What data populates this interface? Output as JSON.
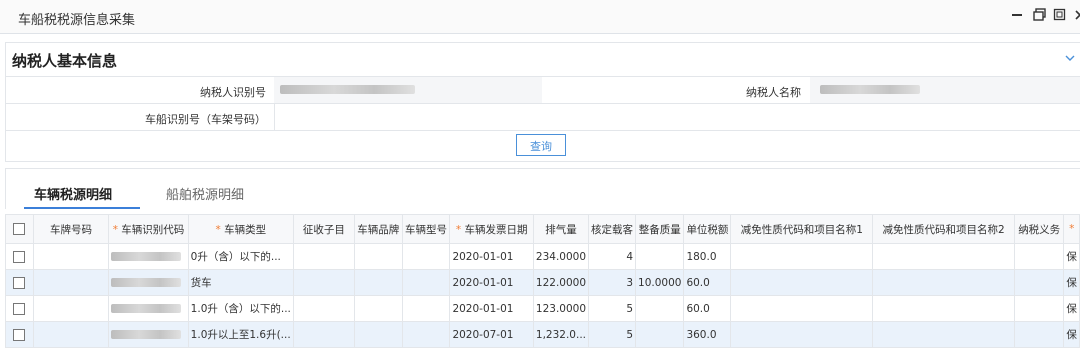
{
  "window": {
    "title": "车船税税源信息采集",
    "controls": [
      "minimize-icon",
      "restore-icon",
      "maximize-icon",
      "close-icon"
    ]
  },
  "taxpayer_section": {
    "title": "纳税人基本信息",
    "id_label": "纳税人识别号",
    "name_label": "纳税人名称",
    "vin_label": "车船识别号（车架号码）",
    "query_button": "查询"
  },
  "tabs": [
    {
      "label": "车辆税源明细"
    },
    {
      "label": "船舶税源明细"
    }
  ],
  "table": {
    "headers": {
      "plate": "车牌号码",
      "vin": "车辆识别代码",
      "type": "车辆类型",
      "sub": "征收子目",
      "brand": "车辆品牌",
      "model": "车辆型号",
      "invoice_date": "车辆发票日期",
      "displacement": "排气量",
      "seats": "核定载客",
      "curb": "整备质量",
      "unit_tax": "单位税额",
      "relief1": "减免性质代码和项目名称1",
      "relief2": "减免性质代码和项目名称2",
      "duty": "纳税义务"
    },
    "rows": [
      {
        "type": "0升（含）以下的...",
        "date": "2020-01-01",
        "displacement": "234.0000",
        "seats": "4",
        "curb": "",
        "unit_tax": "180.0",
        "last": "保"
      },
      {
        "type": "货车",
        "date": "2020-01-01",
        "displacement": "122.0000",
        "seats": "3",
        "curb": "10.0000",
        "unit_tax": "60.0",
        "last": "保"
      },
      {
        "type": "1.0升（含）以下的...",
        "date": "2020-01-01",
        "displacement": "123.0000",
        "seats": "5",
        "curb": "",
        "unit_tax": "60.0",
        "last": "保"
      },
      {
        "type": "1.0升以上至1.6升(...",
        "date": "2020-07-01",
        "displacement": "1,232.0...",
        "seats": "5",
        "curb": "",
        "unit_tax": "360.0",
        "last": "保"
      }
    ]
  },
  "colors": {
    "accent": "#3b7fd9",
    "required": "#f07c34",
    "row_alt": "#eaf2fb"
  }
}
